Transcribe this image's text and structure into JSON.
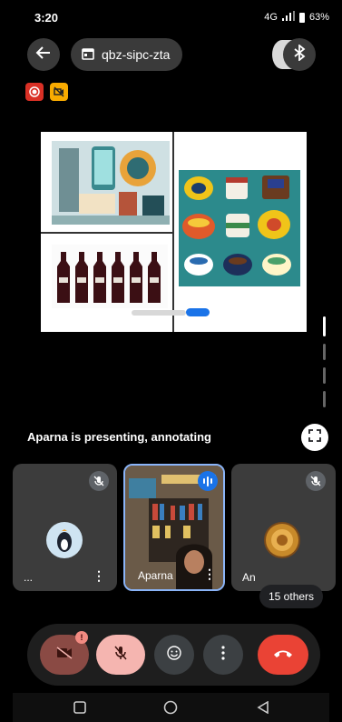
{
  "status": {
    "time": "3:20",
    "network": "4G",
    "battery": "63%"
  },
  "header": {
    "meeting_code": "qbz-sipc-zta"
  },
  "icons": {
    "back": "arrow-left-icon",
    "calendar": "calendar-icon",
    "bluetooth": "bluetooth-icon",
    "record": "record-icon",
    "camera_off": "camera-off-icon",
    "fullscreen": "fullscreen-icon",
    "mic_off": "mic-off-icon",
    "emoji": "emoji-icon",
    "more": "more-vertical-icon",
    "end_call": "phone-hangup-icon"
  },
  "presentation": {
    "status_text": "Aparna is presenting, annotating"
  },
  "participants": [
    {
      "name": "...",
      "muted": true,
      "speaking": false
    },
    {
      "name": "Aparna",
      "muted": false,
      "speaking": true
    },
    {
      "name": "An",
      "muted": true,
      "speaking": false
    }
  ],
  "others_chip": "15 others",
  "colors": {
    "accent_blue": "#1a73e8",
    "end_call_red": "#ea4335",
    "record_red": "#d93025",
    "warning_yellow": "#f9ab00"
  }
}
